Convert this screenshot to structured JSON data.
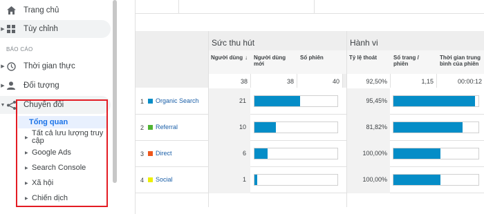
{
  "sidebar": {
    "items": [
      {
        "label": "Trang chủ",
        "icon": "home-icon"
      },
      {
        "label": "Tùy chỉnh",
        "icon": "dashboard-icon"
      },
      {
        "label": "Thời gian thực",
        "icon": "clock-icon"
      },
      {
        "label": "Đối tượng",
        "icon": "person-icon"
      },
      {
        "label": "Chuyển đổi",
        "icon": "conversion-icon"
      }
    ],
    "section_label": "BÁO CÁO",
    "sub_items": [
      {
        "label": "Tổng quan"
      },
      {
        "label": "Tất cả lưu lượng truy cập"
      },
      {
        "label": "Google Ads"
      },
      {
        "label": "Search Console"
      },
      {
        "label": "Xã hội"
      },
      {
        "label": "Chiến dịch"
      }
    ]
  },
  "table": {
    "groups": {
      "acquisition": "Sức thu hút",
      "behavior": "Hành vi"
    },
    "columns": {
      "users": "Người dùng",
      "new_users": "Người dùng mới",
      "sessions": "Số phiên",
      "bounce_rate": "Tỷ lệ thoát",
      "pages_per_session": "Số trang / phiên",
      "avg_duration": "Thời gian trung bình của phiên"
    },
    "totals": {
      "users": "38",
      "new_users": "38",
      "sessions": "40",
      "bounce_rate": "92,50%",
      "pages_per_session": "1,15",
      "avg_duration": "00:00:12"
    },
    "rows": [
      {
        "num": "1",
        "source": "Organic Search",
        "users": "21",
        "new_users_fraction": 0.55,
        "bounce": "95,45%",
        "pages_fraction": 0.96,
        "color": "#058dc7"
      },
      {
        "num": "2",
        "source": "Referral",
        "users": "10",
        "new_users_fraction": 0.26,
        "bounce": "81,82%",
        "pages_fraction": 0.81,
        "color": "#50b432"
      },
      {
        "num": "3",
        "source": "Direct",
        "users": "6",
        "new_users_fraction": 0.16,
        "bounce": "100,00%",
        "pages_fraction": 0.55,
        "color": "#ed561b"
      },
      {
        "num": "4",
        "source": "Social",
        "users": "1",
        "new_users_fraction": 0.03,
        "bounce": "100,00%",
        "pages_fraction": 0.55,
        "color": "#edef00"
      }
    ]
  },
  "colors": {
    "accent": "#1a73e8",
    "bar": "#058dc7",
    "highlight_box": "#e31b23"
  }
}
